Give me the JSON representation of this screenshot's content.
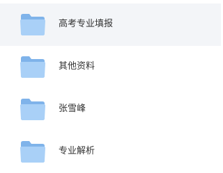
{
  "folders": [
    {
      "label": "高考专业填报",
      "icon": "folder-icon",
      "selected": true
    },
    {
      "label": "其他资料",
      "icon": "folder-icon",
      "selected": false
    },
    {
      "label": "张雪峰",
      "icon": "folder-icon",
      "selected": false
    },
    {
      "label": "专业解析",
      "icon": "folder-icon",
      "selected": false
    }
  ],
  "colors": {
    "selected_row_bg": "#f3f5f8",
    "folder_back": "#7fb3ea",
    "folder_front": "#a9d0f7",
    "text": "#333333"
  }
}
